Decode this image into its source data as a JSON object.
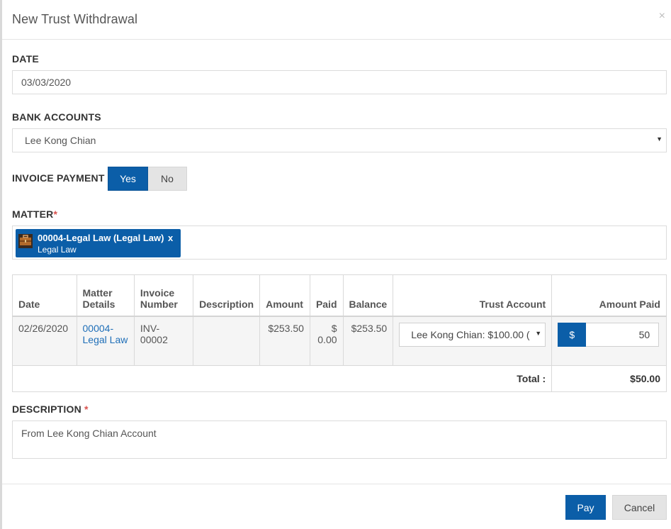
{
  "dialog": {
    "title": "New Trust Withdrawal",
    "close_icon": "×"
  },
  "date": {
    "label": "DATE",
    "value": "03/03/2020"
  },
  "bank_accounts": {
    "label": "BANK ACCOUNTS",
    "selected": "Lee Kong Chian",
    "arrow": "▼"
  },
  "invoice_payment": {
    "label": "INVOICE PAYMENT",
    "yes": "Yes",
    "no": "No",
    "selected": "Yes"
  },
  "matter": {
    "label": "MATTER",
    "required_mark": "*",
    "chip": {
      "title": "00004-Legal Law (Legal Law)",
      "subtitle": "Legal Law",
      "remove": "x",
      "icon": "briefcase-icon"
    }
  },
  "table": {
    "headers": {
      "date": "Date",
      "matter_details": "Matter Details",
      "invoice_number": "Invoice Number",
      "description": "Description",
      "amount": "Amount",
      "paid": "Paid",
      "balance": "Balance",
      "trust_account": "Trust Account",
      "amount_paid": "Amount Paid"
    },
    "rows": [
      {
        "date": "02/26/2020",
        "matter_details": "00004-Legal Law",
        "invoice_number": "INV-00002",
        "description": "",
        "amount": "$253.50",
        "paid": "$ 0.00",
        "balance": "$253.50",
        "trust_account": "Lee Kong Chian: $100.00 (",
        "currency_symbol": "$",
        "amount_paid": "50"
      }
    ],
    "total_label": "Total :",
    "total_value": "$50.00"
  },
  "description": {
    "label": "DESCRIPTION",
    "required_mark": "*",
    "value": "From Lee Kong Chian Account"
  },
  "buttons": {
    "pay": "Pay",
    "cancel": "Cancel"
  },
  "colors": {
    "primary": "#0b5ea8",
    "link": "#1f6fb8",
    "required": "#d9534f"
  }
}
